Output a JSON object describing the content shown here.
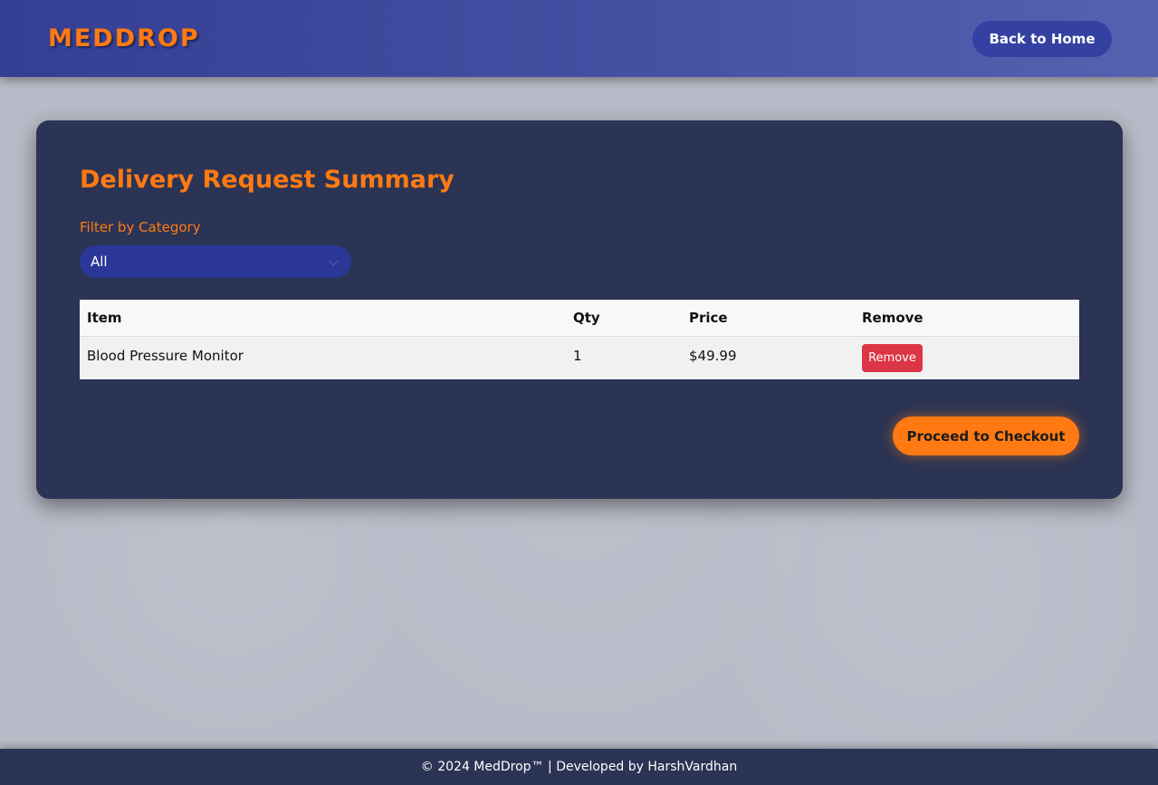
{
  "header": {
    "logo": "MEDDROP",
    "back_button": "Back to Home"
  },
  "summary": {
    "title": "Delivery Request Summary",
    "filter_label": "Filter by Category",
    "filter_value": "All",
    "columns": [
      "Item",
      "Qty",
      "Price",
      "Remove"
    ],
    "rows": [
      {
        "item": "Blood Pressure Monitor",
        "qty": "1",
        "price": "$49.99",
        "remove": "Remove"
      }
    ],
    "checkout_button": "Proceed to Checkout"
  },
  "footer": {
    "text": "© 2024 MedDrop™ | Developed by HarshVardhan"
  },
  "colors": {
    "accent": "#ff7a12",
    "header_bg": "#3c479b",
    "card_bg": "#2b3454",
    "remove_button": "#dc3545"
  }
}
